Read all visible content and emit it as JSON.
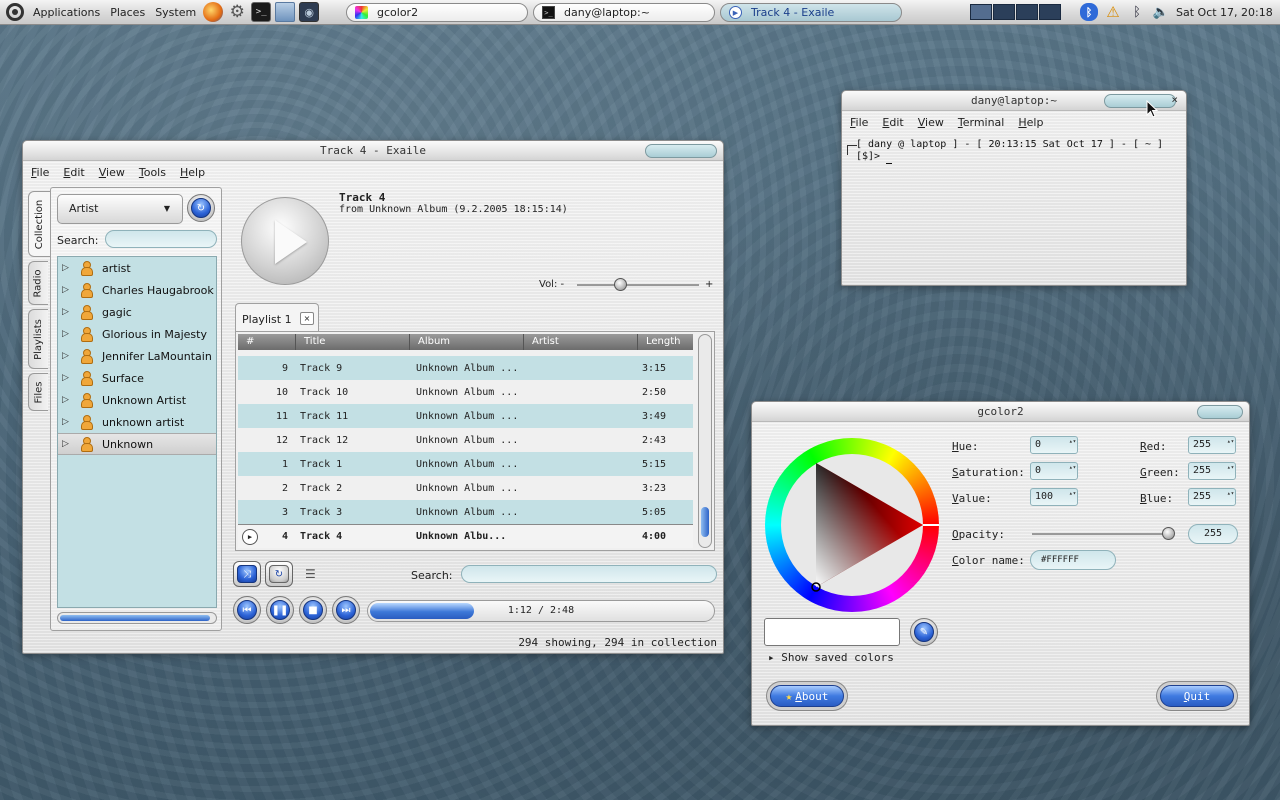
{
  "panel": {
    "menus": [
      "Applications",
      "Places",
      "System"
    ],
    "launchers": [
      "firefox-icon",
      "settings-gear-icon",
      "terminal-icon",
      "folder-icon",
      "screenshot-icon"
    ],
    "tasks": [
      {
        "label": "gcolor2"
      },
      {
        "label": "dany@laptop:~"
      },
      {
        "label": "Track 4 - Exaile"
      }
    ],
    "clock": "Sat Oct 17, 20:18"
  },
  "exaile": {
    "title": "Track 4 - Exaile",
    "menu": [
      "File",
      "Edit",
      "View",
      "Tools",
      "Help"
    ],
    "side_tabs": [
      "Collection",
      "Radio",
      "Playlists",
      "Files"
    ],
    "collection": {
      "mode": "Artist",
      "search_label": "Search:",
      "search_value": "",
      "artists": [
        "artist",
        "Charles Haugabrook",
        "gagic",
        "Glorious in Majesty",
        "Jennifer LaMountain",
        "Surface",
        "Unknown Artist",
        "unknown artist",
        "Unknown"
      ],
      "selected": "Unknown"
    },
    "now_playing": {
      "title": "Track 4",
      "subtitle": "from Unknown Album (9.2.2005 18:15:14)",
      "volume_label": "Vol: -",
      "volume_plus": "+",
      "volume_level": 0.35
    },
    "playlist": {
      "tab_label": "Playlist 1",
      "tab_close": "×",
      "columns": [
        "#",
        "Title",
        "Album",
        "Artist",
        "Length"
      ],
      "rows": [
        {
          "num": "9",
          "title": "Track 9",
          "album": "Unknown Album ...",
          "artist": "",
          "length": "3:15"
        },
        {
          "num": "10",
          "title": "Track 10",
          "album": "Unknown Album ...",
          "artist": "",
          "length": "2:50"
        },
        {
          "num": "11",
          "title": "Track 11",
          "album": "Unknown Album ...",
          "artist": "",
          "length": "3:49"
        },
        {
          "num": "12",
          "title": "Track 12",
          "album": "Unknown Album ...",
          "artist": "",
          "length": "2:43"
        },
        {
          "num": "1",
          "title": "Track 1",
          "album": "Unknown Album ...",
          "artist": "",
          "length": "5:15"
        },
        {
          "num": "2",
          "title": "Track 2",
          "album": "Unknown Album ...",
          "artist": "",
          "length": "3:23"
        },
        {
          "num": "3",
          "title": "Track 3",
          "album": "Unknown Album ...",
          "artist": "",
          "length": "5:05"
        },
        {
          "num": "4",
          "title": "Track 4",
          "album": "Unknown Albu...",
          "artist": "",
          "length": "4:00"
        }
      ],
      "now_playing_index": 7
    },
    "search_label": "Search:",
    "search_value": "",
    "progress": {
      "text": "1:12 / 2:48",
      "fraction": 0.3
    },
    "status": "294 showing, 294 in collection"
  },
  "terminal": {
    "title": "dany@laptop:~",
    "close": "×",
    "menu": [
      "File",
      "Edit",
      "View",
      "Terminal",
      "Help"
    ],
    "line1": "[ dany @ laptop ] - [ 20:13:15 Sat Oct 17 ] - [ ~ ]",
    "line2": "[$]> "
  },
  "gcolor": {
    "title": "gcolor2",
    "hue_label": "Hue:",
    "hue": "0",
    "saturation_label": "Saturation:",
    "saturation": "0",
    "value_label": "Value:",
    "value": "100",
    "red_label": "Red:",
    "red": "255",
    "green_label": "Green:",
    "green": "255",
    "blue_label": "Blue:",
    "blue": "255",
    "opacity_label": "Opacity:",
    "opacity": "255",
    "colorname_label": "Color name:",
    "colorname": "#FFFFFF",
    "saved_colors": "Show saved colors",
    "about": "About",
    "quit": "Quit",
    "current_color": "#FFFFFF"
  },
  "colors": {
    "accent_blue": "#2b62d6",
    "list_teal": "#c3e0e4",
    "field_teal": "#cfe6eb"
  }
}
